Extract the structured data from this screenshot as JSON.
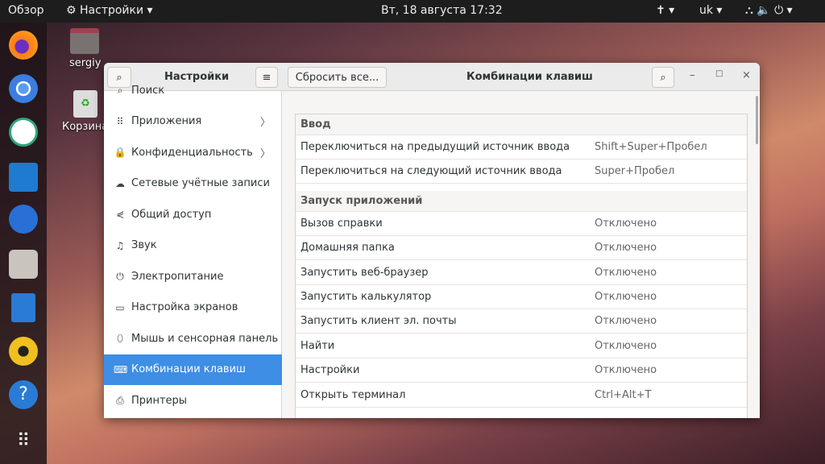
{
  "topbar": {
    "activities": "Обзор",
    "app_menu": "Настройки ▾",
    "clock": "Вт, 18 августа  17:32",
    "accessibility": "✝ ▾",
    "keyboard_layout": "uk ▾",
    "system": "⛬ 🔈 ⏻ ▾"
  },
  "desktop": {
    "home": "sergiy",
    "trash": "Корзина"
  },
  "window": {
    "sidebar_title": "Настройки",
    "reset_button": "Сбросить все...",
    "title": "Комбинации клавиш",
    "sidebar": [
      {
        "label": "Поиск",
        "icon": "⌕"
      },
      {
        "label": "Приложения",
        "icon": "⠿",
        "chevron": "〉"
      },
      {
        "label": "Конфиденциальность",
        "icon": "🔒",
        "chevron": "〉"
      },
      {
        "label": "Сетевые учётные записи",
        "icon": "☁"
      },
      {
        "label": "Общий доступ",
        "icon": "⋞"
      },
      {
        "label": "Звук",
        "icon": "♫"
      },
      {
        "label": "Электропитание",
        "icon": "⏻"
      },
      {
        "label": "Настройка экранов",
        "icon": "▭"
      },
      {
        "label": "Мышь и сенсорная панель",
        "icon": "⬯"
      },
      {
        "label": "Комбинации клавиш",
        "icon": "⌨"
      },
      {
        "label": "Принтеры",
        "icon": "⎙"
      }
    ],
    "sections": [
      {
        "title": "Ввод",
        "rows": [
          {
            "name": "Переключиться на предыдущий источник ввода",
            "accel": "Shift+Super+Пробел"
          },
          {
            "name": "Переключиться на следующий источник ввода",
            "accel": "Super+Пробел"
          }
        ]
      },
      {
        "title": "Запуск приложений",
        "rows": [
          {
            "name": "Вызов справки",
            "accel": "Отключено"
          },
          {
            "name": "Домашняя папка",
            "accel": "Отключено"
          },
          {
            "name": "Запустить веб-браузер",
            "accel": "Отключено"
          },
          {
            "name": "Запустить калькулятор",
            "accel": "Отключено"
          },
          {
            "name": "Запустить клиент эл. почты",
            "accel": "Отключено"
          },
          {
            "name": "Найти",
            "accel": "Отключено"
          },
          {
            "name": "Настройки",
            "accel": "Отключено"
          },
          {
            "name": "Открыть терминал",
            "accel": "Ctrl+Alt+T"
          }
        ]
      }
    ]
  }
}
